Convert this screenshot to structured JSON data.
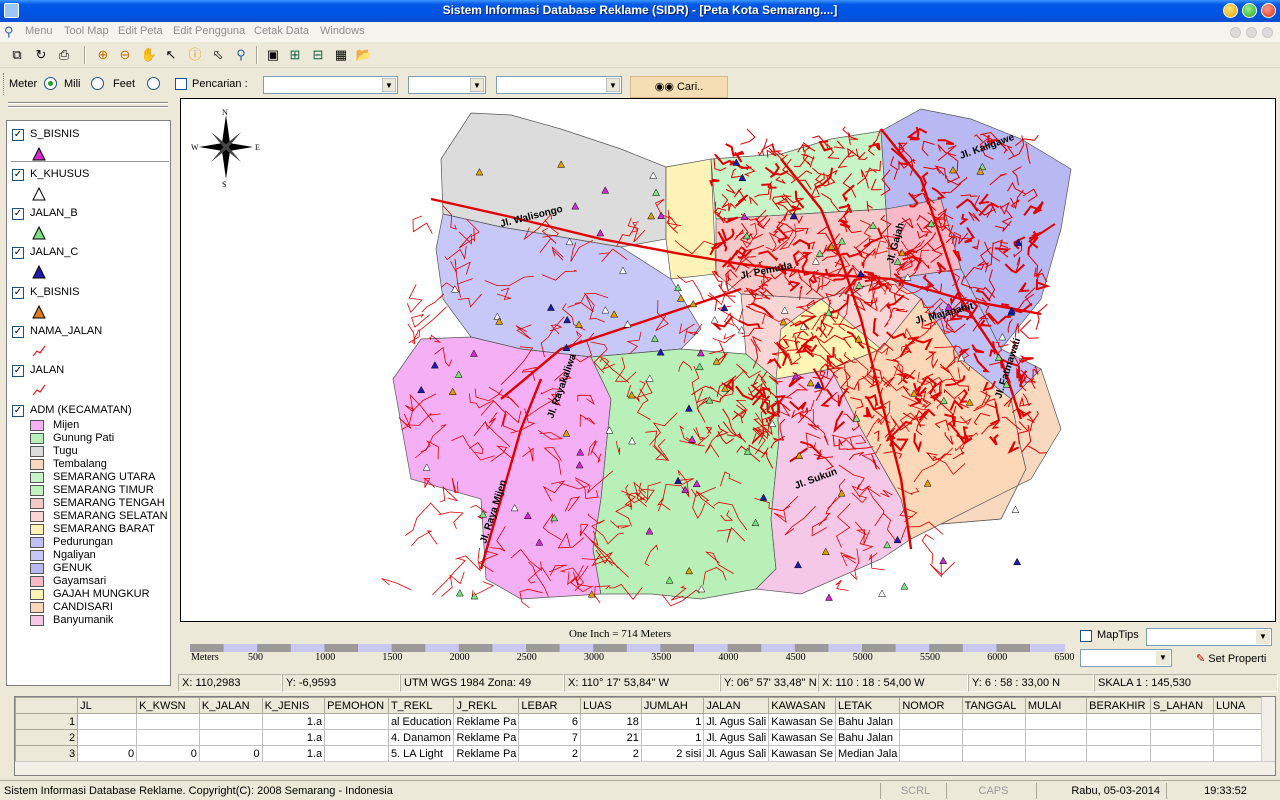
{
  "window": {
    "title": "Sistem Informasi Database Reklame (SIDR) - [Peta Kota Semarang....]"
  },
  "menu": [
    "Menu",
    "Tool Map",
    "Edit Peta",
    "Edit Pengguna",
    "Cetak Data",
    "Windows"
  ],
  "toolbar_icons": [
    "copy-icon",
    "redo-icon",
    "print-icon",
    "zoom-in-icon",
    "zoom-out-icon",
    "pan-icon",
    "select-arrow-icon",
    "info-icon",
    "select-area-icon",
    "find-icon",
    "full-extent-icon",
    "zoom-window-icon",
    "zoom-prev-icon",
    "layer-icon",
    "open-folder-icon"
  ],
  "search": {
    "unit_label": "Meter",
    "mili_label": "Mili",
    "feet_label": "Feet",
    "search_label": "Pencarian :",
    "search_button": "Cari.."
  },
  "legend": {
    "layers": [
      {
        "name": "S_BISNIS",
        "color": "#d22ad2"
      },
      {
        "name": "K_KHUSUS",
        "color": "#ffffff"
      },
      {
        "name": "JALAN_B",
        "color": "#7fe07f"
      },
      {
        "name": "JALAN_C",
        "color": "#1c1cb0"
      },
      {
        "name": "K_BISNIS",
        "color": "#e07a1c"
      },
      {
        "name": "NAMA_JALAN",
        "color": "#e02020"
      },
      {
        "name": "JALAN",
        "color": "#e02020"
      }
    ],
    "adm_layer": "ADM (KECAMATAN)",
    "categories": [
      {
        "name": "Mijen",
        "color": "#f5b0f5"
      },
      {
        "name": "Gunung Pati",
        "color": "#b8f0b8"
      },
      {
        "name": "Tugu",
        "color": "#dcdcdc"
      },
      {
        "name": "Tembalang",
        "color": "#f8d9c0"
      },
      {
        "name": "SEMARANG UTARA",
        "color": "#c8f5c8"
      },
      {
        "name": "SEMARANG TIMUR",
        "color": "#bff2bf"
      },
      {
        "name": "SEMARANG TENGAH",
        "color": "#f6c8c8"
      },
      {
        "name": "SEMARANG SELATAN",
        "color": "#fbd4d4"
      },
      {
        "name": "SEMARANG BARAT",
        "color": "#fff3b8"
      },
      {
        "name": "Pedurungan",
        "color": "#c0c0f5"
      },
      {
        "name": "Ngaliyan",
        "color": "#c8c8f8"
      },
      {
        "name": "GENUK",
        "color": "#b8b8f2"
      },
      {
        "name": "Gayamsari",
        "color": "#f8b8c8"
      },
      {
        "name": "GAJAH MUNGKUR",
        "color": "#fff5b5"
      },
      {
        "name": "CANDISARI",
        "color": "#fcd8b8"
      },
      {
        "name": "Banyumanik",
        "color": "#f5c8e8"
      }
    ]
  },
  "map": {
    "compass": {
      "n": "N",
      "s": "S",
      "e": "E",
      "w": "W"
    },
    "street_labels": [
      "Jl. Walisongo",
      "Jl. Pemuda",
      "Jl. Majapahit",
      "Jl. Kaligawe",
      "Jl. Raya Mijen",
      "Jl. Rayakaliwa",
      "Jl. Fatmawati",
      "Jl. Sukun",
      "Jl. Gajah"
    ]
  },
  "scale": {
    "title": "One Inch = 714 Meters",
    "unit": "Meters",
    "ticks": [
      "500",
      "1000",
      "1500",
      "2000",
      "2500",
      "3000",
      "3500",
      "4000",
      "4500",
      "5000",
      "5500",
      "6000",
      "6500"
    ],
    "maptips_label": "MapTips",
    "set_properti": "Set Properti"
  },
  "coords": {
    "x": "X: 110,2983",
    "y": "Y: -6,9593",
    "utm": "UTM WGS 1984 Zona: 49",
    "x_dms": "X: 110° 17' 53,84'' W",
    "y_dms": "Y: 06° 57' 33,48'' N",
    "x_dm": "X: 110 : 18 : 54,00 W",
    "y_dm": "Y: 6 : 58 : 33,00 N",
    "skala": "SKALA 1 : 145,530"
  },
  "grid": {
    "columns": [
      "JL",
      "K_KWSN",
      "K_JALAN",
      "K_JENIS",
      "PEMOHON",
      "T_REKL",
      "J_REKL",
      "LEBAR",
      "LUAS",
      "JUMLAH",
      "JALAN",
      "KAWASAN",
      "LETAK",
      "NOMOR",
      "TANGGAL",
      "MULAI",
      "BERAKHIR",
      "S_LAHAN",
      "LUNA"
    ],
    "rows": [
      {
        "n": "1",
        "cells": [
          "",
          "",
          "",
          "1.a",
          "",
          "al Education",
          "Reklame Pa",
          "6",
          "18",
          "1",
          "Jl. Agus Sali",
          "Kawasan Se",
          "Bahu Jalan",
          "",
          "",
          "",
          "",
          "",
          ""
        ]
      },
      {
        "n": "2",
        "cells": [
          "",
          "",
          "",
          "1.a",
          "",
          "4. Danamon",
          "Reklame Pa",
          "7",
          "21",
          "1",
          "Jl. Agus Sali",
          "Kawasan Se",
          "Bahu Jalan",
          "",
          "",
          "",
          "",
          "",
          ""
        ]
      },
      {
        "n": "3",
        "cells": [
          "0",
          "0",
          "0",
          "1.a",
          "",
          "5. LA Light",
          "Reklame Pa",
          "2",
          "2",
          "2 sisi",
          "Jl. Agus Sali",
          "Kawasan Se",
          "Median Jala",
          "",
          "",
          "",
          "",
          "",
          ""
        ]
      }
    ]
  },
  "status": {
    "copyright": "Sistem Informasi Database Reklame. Copyright(C): 2008 Semarang - Indonesia",
    "scrl": "SCRL",
    "caps": "CAPS",
    "date": "Rabu, 05-03-2014",
    "time": "19:33:52"
  }
}
